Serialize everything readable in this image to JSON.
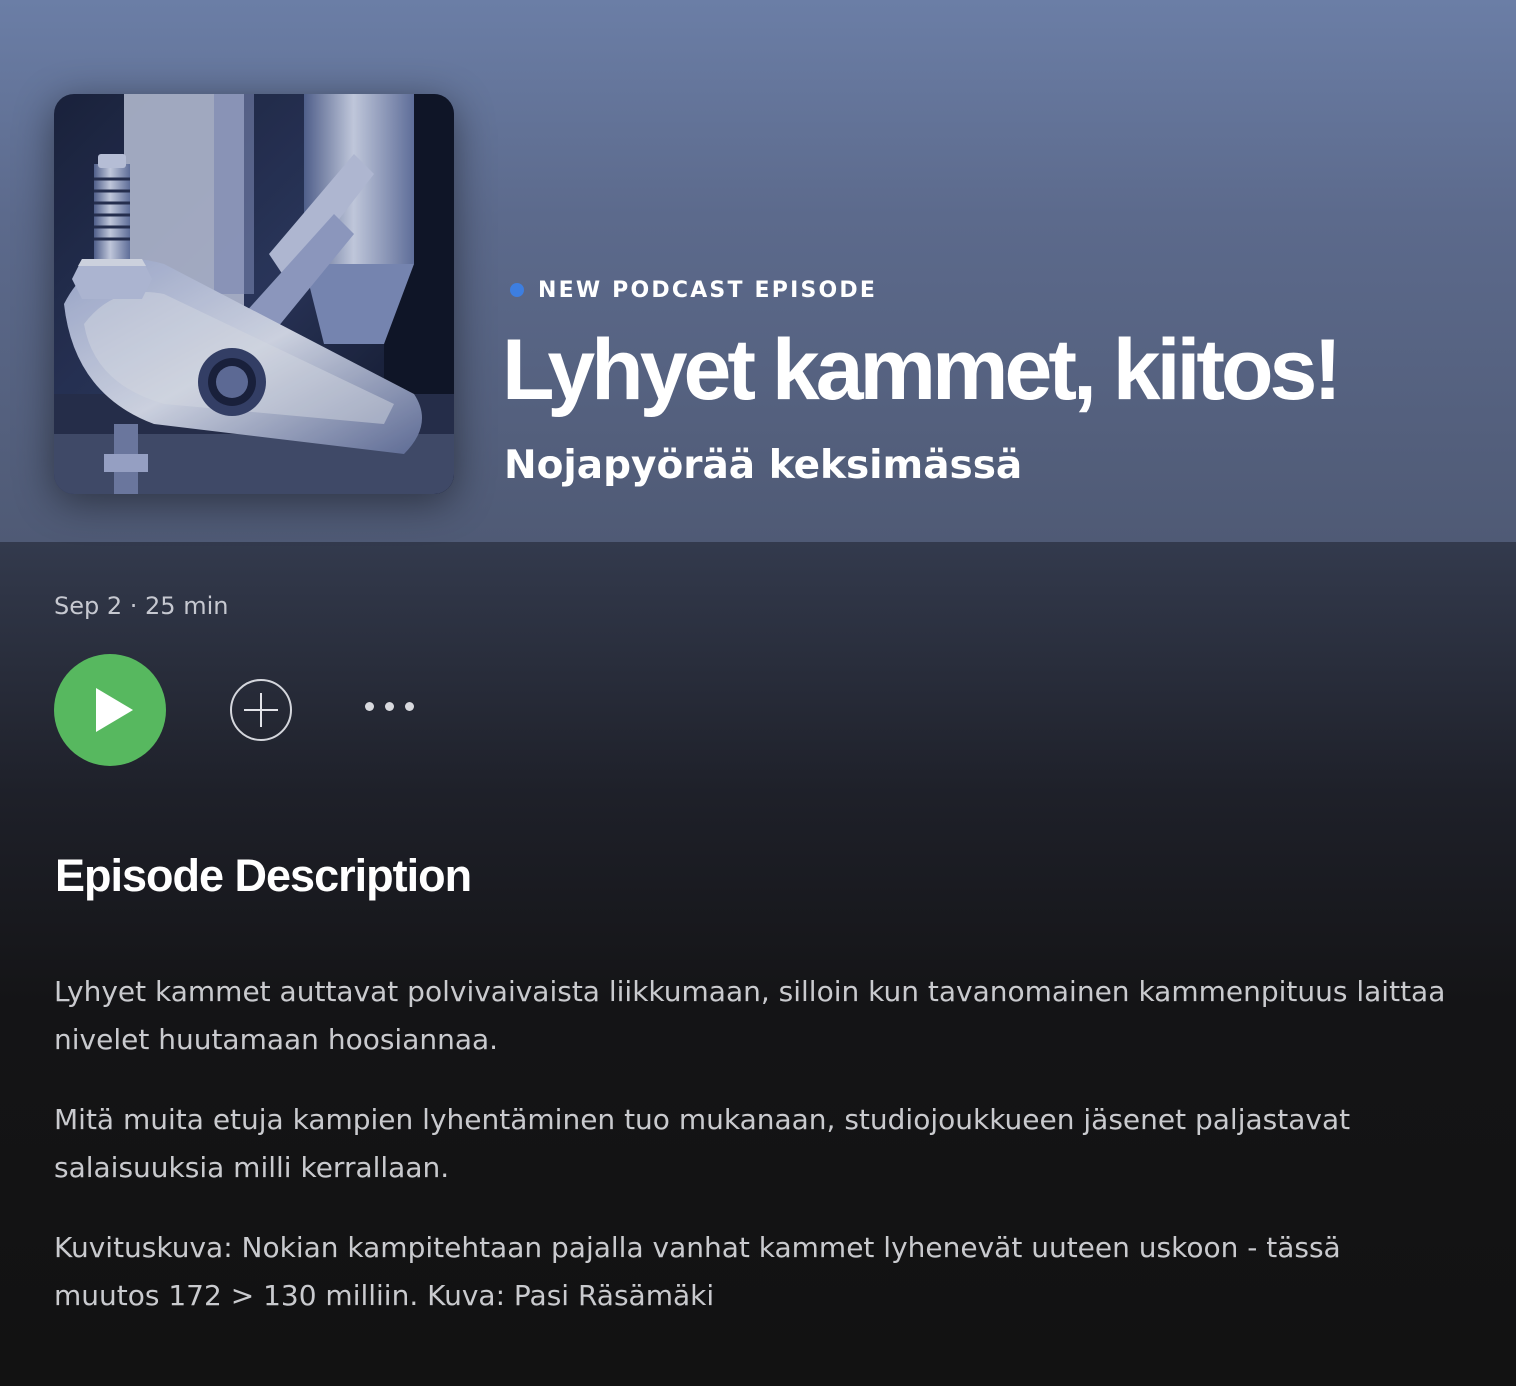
{
  "episode": {
    "badge_label": "NEW PODCAST EPISODE",
    "title": "Lyhyet kammet, kiitos!",
    "show_name": "Nojapyörää keksimässä",
    "meta": "Sep 2 · 25 min",
    "cover_image": "workshop-crank-photo"
  },
  "actions": {
    "play_icon": "play-icon",
    "add_icon": "plus-circle-icon",
    "more_icon": "ellipsis-icon"
  },
  "description": {
    "heading": "Episode Description",
    "paragraphs": [
      "Lyhyet kammet auttavat polvivaivaista liikkumaan, silloin kun tavanomainen kammenpituus laittaa nivelet huutamaan hoosiannaa.",
      "Mitä muita etuja kampien lyhentäminen tuo mukanaan, studiojoukkueen jäsenet paljastavat salaisuuksia milli kerrallaan.",
      "Kuvituskuva: Nokian kampitehtaan pajalla vanhat kammet lyhenevät uuteen uskoon - tässä muutos 172 > 130 milliin. Kuva: Pasi Räsämäki"
    ]
  },
  "colors": {
    "header_gradient_top": "#6b7ea6",
    "header_gradient_bottom": "#4f5a75",
    "play_button": "#57b85f",
    "badge_dot": "#3d7ee0",
    "background": "#121212"
  }
}
